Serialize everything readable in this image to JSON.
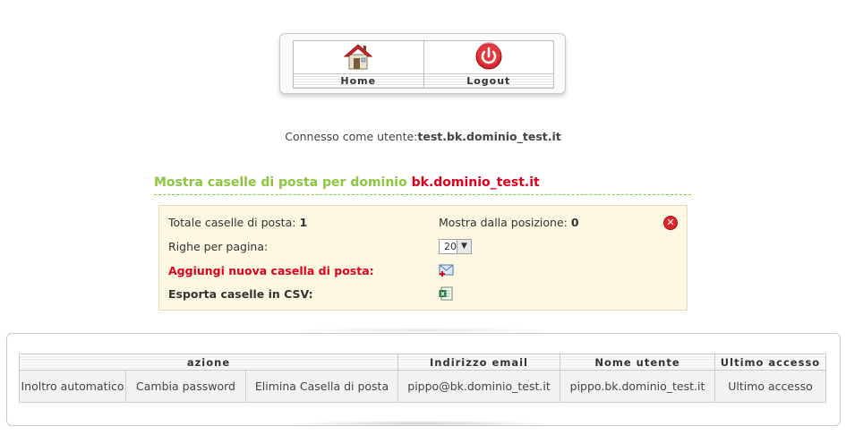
{
  "nav": {
    "home_label": "Home",
    "logout_label": "Logout",
    "home_icon": "house-icon",
    "logout_icon": "power-icon"
  },
  "status": {
    "connected_prefix": "Connesso come utente:",
    "connected_user": "test.bk.dominio_test.it"
  },
  "section": {
    "title_prefix": "Mostra caselle di posta per dominio",
    "title_domain": "bk.dominio_test.it"
  },
  "info": {
    "total_label": "Totale caselle di posta:",
    "total_value": "1",
    "position_label": "Mostra dalla posizione:",
    "position_value": "0",
    "rows_label": "Righe per pagina:",
    "rows_value": "20",
    "add_label": "Aggiungi nuova casella di posta:",
    "export_label": "Esporta caselle in CSV:"
  },
  "table": {
    "headers": {
      "azione": "azione",
      "email": "Indirizzo email",
      "user": "Nome utente",
      "last": "Ultimo accesso"
    },
    "rows": [
      {
        "forward": "Inoltro automatico",
        "change_pw": "Cambia password",
        "delete": "Elimina Casella di posta",
        "email": "pippo@bk.dominio_test.it",
        "user": "pippo.bk.dominio_test.it",
        "last": "Ultimo accesso"
      }
    ]
  },
  "colors": {
    "accent_green": "#8dc63f",
    "accent_red": "#e0001b",
    "info_bg": "#fdf8e2"
  }
}
